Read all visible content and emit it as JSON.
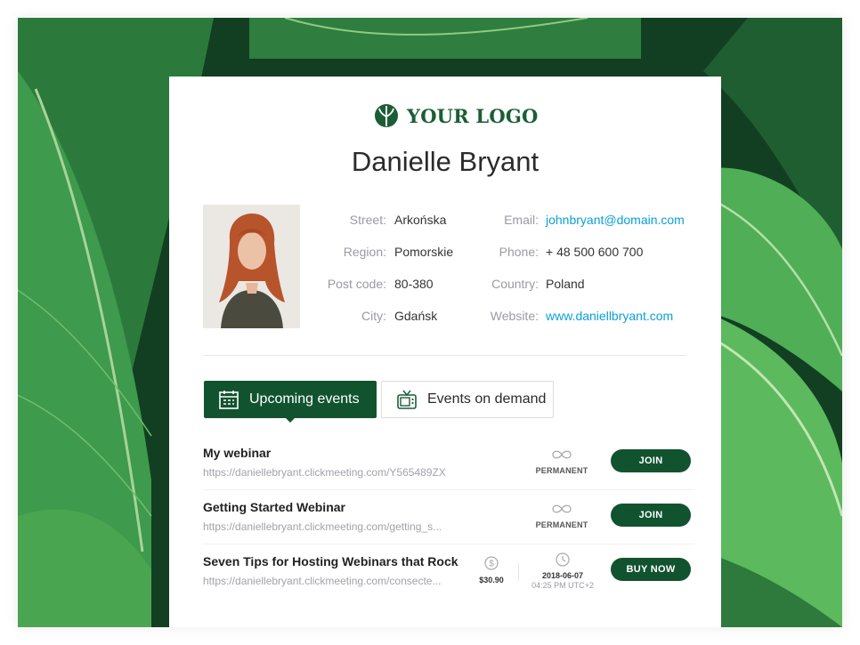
{
  "logo": {
    "text": "YOUR LOGO",
    "icon": "tree-icon",
    "color": "#1b5e35"
  },
  "profile": {
    "name": "Danielle Bryant",
    "address": [
      {
        "label": "Street:",
        "value": "Arkońska"
      },
      {
        "label": "Region:",
        "value": "Pomorskie"
      },
      {
        "label": "Post code:",
        "value": "80-380"
      },
      {
        "label": "City:",
        "value": "Gdańsk"
      }
    ],
    "contact": [
      {
        "label": "Email:",
        "value": "johnbryant@domain.com"
      },
      {
        "label": "Phone:",
        "value": "+ 48 500 600 700"
      },
      {
        "label": "Country:",
        "value": "Poland"
      },
      {
        "label": "Website:",
        "value": "www.daniellbryant.com"
      }
    ]
  },
  "tabs": [
    {
      "label": "Upcoming events",
      "icon": "calendar-icon",
      "active": true
    },
    {
      "label": "Events on demand",
      "icon": "tv-icon",
      "active": false
    }
  ],
  "events": [
    {
      "title": "My webinar",
      "url": "https://daniellebryant.clickmeeting.com/Y565489ZX",
      "status": "PERMANENT",
      "button": "JOIN"
    },
    {
      "title": "Getting Started Webinar",
      "url": "https://daniellebryant.clickmeeting.com/getting_s...",
      "status": "PERMANENT",
      "button": "JOIN"
    },
    {
      "title": "Seven Tips for Hosting Webinars that Rock",
      "url": "https://daniellebryant.clickmeeting.com/consecte...",
      "price": "$30.90",
      "date": "2018-06-07",
      "time": "04:25 PM UTC+2",
      "button": "BUY NOW"
    }
  ],
  "colors": {
    "brand": "#12532f",
    "link": "#0aa0d8"
  }
}
